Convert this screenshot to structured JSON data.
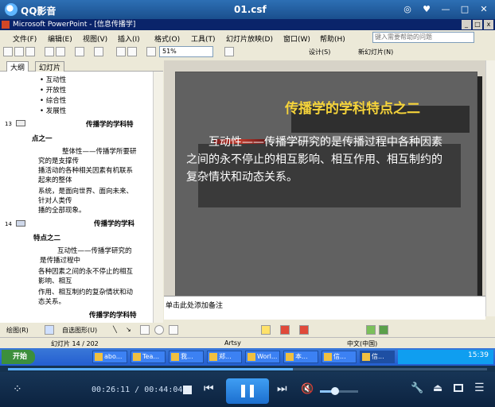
{
  "player": {
    "app_name": "QQ影音",
    "file_name": "01.csf",
    "current_time": "00:26:11",
    "total_time": "00:44:04",
    "time_display": "00:26:11 / 00:44:04",
    "progress_fraction": 0.594,
    "volume_fraction": 0.4,
    "icons": [
      "feet-icon",
      "stop-icon",
      "prev-icon",
      "pause-icon",
      "next-icon",
      "volume-muted-icon",
      "wrench-icon",
      "eject-icon",
      "screen-icon",
      "menu-icon"
    ]
  },
  "powerpoint": {
    "title": "Microsoft PowerPoint - [信息传播学]",
    "menus": [
      "文件(F)",
      "编辑(E)",
      "视图(V)",
      "插入(I)",
      "格式(O)",
      "工具(T)",
      "幻灯片放映(D)",
      "窗口(W)",
      "帮助(H)"
    ],
    "help_placeholder": "键入需要帮助的问题",
    "zoom": "51%",
    "design_label": "设计(S)",
    "new_slide_label": "新幻灯片(N)",
    "outline_tab": "大纲",
    "slides_tab": "幻灯片",
    "outline": {
      "bullets": [
        "互动性",
        "开放性",
        "综合性",
        "发展性"
      ],
      "slide13_number": "13",
      "slide13_title": "传播学的学科特",
      "slide13_title2": "点之一",
      "slide13_lines": [
        "整体性——传播学所要研",
        "究的是支撑传",
        "播活动的各种相关因素有机联系",
        "起来的整体",
        "系统，是面向世界、面向未来、",
        "针对人类传",
        "播的全部现象。"
      ],
      "slide14_number": "14",
      "slide14_title": "传播学的学科",
      "slide14_title2": "特点之二",
      "slide14_lines": [
        "互动性——传播学研究的",
        "是传播过程中",
        "各种因素之间的永不停止的相互",
        "影响、相互",
        "作用、相互制约的复杂情状和动",
        "态关系。"
      ],
      "slide15_title": "传播学的学科特"
    },
    "slide": {
      "title": "传播学的学科特点之二",
      "body": "　　互动性——传播学研究的是传播过程中各种因素之间的永不停止的相互影响、相互作用、相互制约的复杂情状和动态关系。"
    },
    "notes_placeholder": "单击此处添加备注",
    "draw_label": "绘图(R)",
    "autoshape_label": "自选图形(U)",
    "status": {
      "slide_info": "幻灯片 14 / 202",
      "design": "Artsy",
      "language": "中文(中国)"
    }
  },
  "taskbar": {
    "start": "开始",
    "tasks": [
      "abo...",
      "Tea...",
      "我...",
      "郑...",
      "Worl...",
      "本...",
      "信...",
      "信..."
    ],
    "clock": "15:39"
  },
  "colors": {
    "title_text": "#f5d33a",
    "slide_bg": "#616161",
    "player_accent": "#3f9ef3"
  }
}
